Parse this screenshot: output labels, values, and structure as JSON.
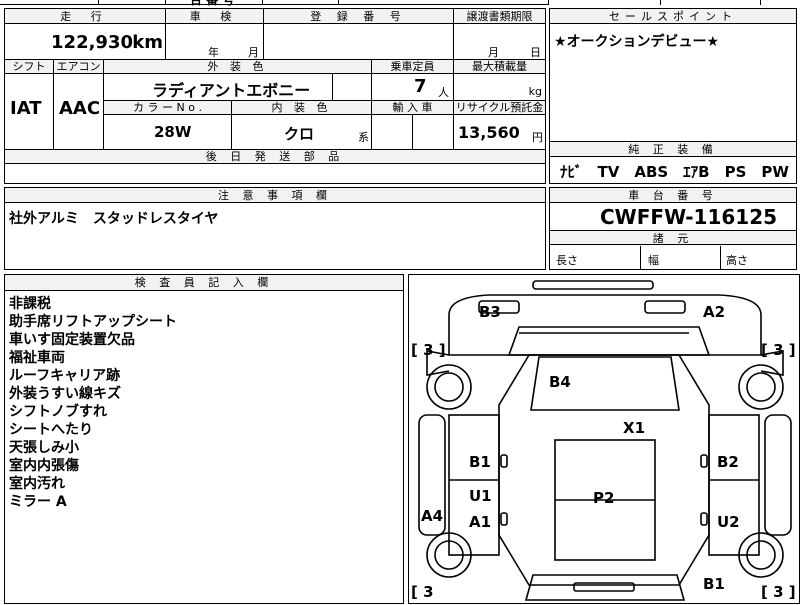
{
  "top_fragment": "台 番 号",
  "mileage": {
    "header": "走 行",
    "value": "122,930",
    "unit": "km"
  },
  "inspection": {
    "header": "車 検",
    "year_unit": "年",
    "month_unit": "月"
  },
  "registration": {
    "header": "登 録 番 号"
  },
  "transfer": {
    "header": "譲渡書類期限",
    "month_unit": "月",
    "day_unit": "日"
  },
  "sales_point": {
    "header": "セールスポイント",
    "text": "★オークションデビュー★"
  },
  "shift": {
    "header": "シフト",
    "value": "IAT"
  },
  "aircon": {
    "header": "エアコン",
    "value": "AAC"
  },
  "exterior_color": {
    "header": "外 装 色",
    "value": "ラディアントエボニー"
  },
  "capacity": {
    "header": "乗車定員",
    "value": "7",
    "unit": "人"
  },
  "max_load": {
    "header": "最大積載量",
    "unit": "kg"
  },
  "color_no": {
    "header": "カ ラ ー N o .",
    "value": "28W"
  },
  "interior_color": {
    "header": "内 装 色",
    "value": "クロ",
    "suffix": "系"
  },
  "import": {
    "header": "輸 入 車"
  },
  "recycle": {
    "header": "リサイクル預託金",
    "value": "13,560",
    "unit": "円"
  },
  "later_parts": {
    "header": "後 日 発 送 部 品"
  },
  "equipment": {
    "header": "純 正 装 備",
    "value": "ﾅﾋﾞ　TV　ABS　ｴｱB　PS　PW"
  },
  "caution": {
    "header": "注 意 事 項 欄",
    "text": "社外アルミ　スタッドレスタイヤ"
  },
  "chassis": {
    "header": "車 台 番 号",
    "value": "CWFFW-116125"
  },
  "dimensions": {
    "header": "諸 元",
    "length": "長さ",
    "width": "幅",
    "height": "高さ"
  },
  "inspector": {
    "header": "検 査 員 記 入 欄",
    "notes": [
      "非課税",
      "助手席リフトアップシート",
      "車いす固定装置欠品",
      "福祉車両",
      "ルーフキャリア跡",
      "外装うすい線キズ",
      "シフトノブすれ",
      "シートへたり",
      "天張しみ小",
      "室内内張傷",
      "室内汚れ",
      "ミラー A"
    ]
  },
  "diagram": {
    "labels": {
      "b3": "B3",
      "a2": "A2",
      "b4": "B4",
      "x1": "X1",
      "b1_left": "B1",
      "b2": "B2",
      "u1": "U1",
      "p2": "P2",
      "a4": "A4",
      "a1": "A1",
      "u2": "U2",
      "b1_bottom": "B1"
    },
    "tire_left_top": "[ 3 ]",
    "tire_right_top": "[ 3 ]",
    "tire_left_bottom": "[ 3",
    "tire_right_bottom": "[ 3 ]"
  }
}
